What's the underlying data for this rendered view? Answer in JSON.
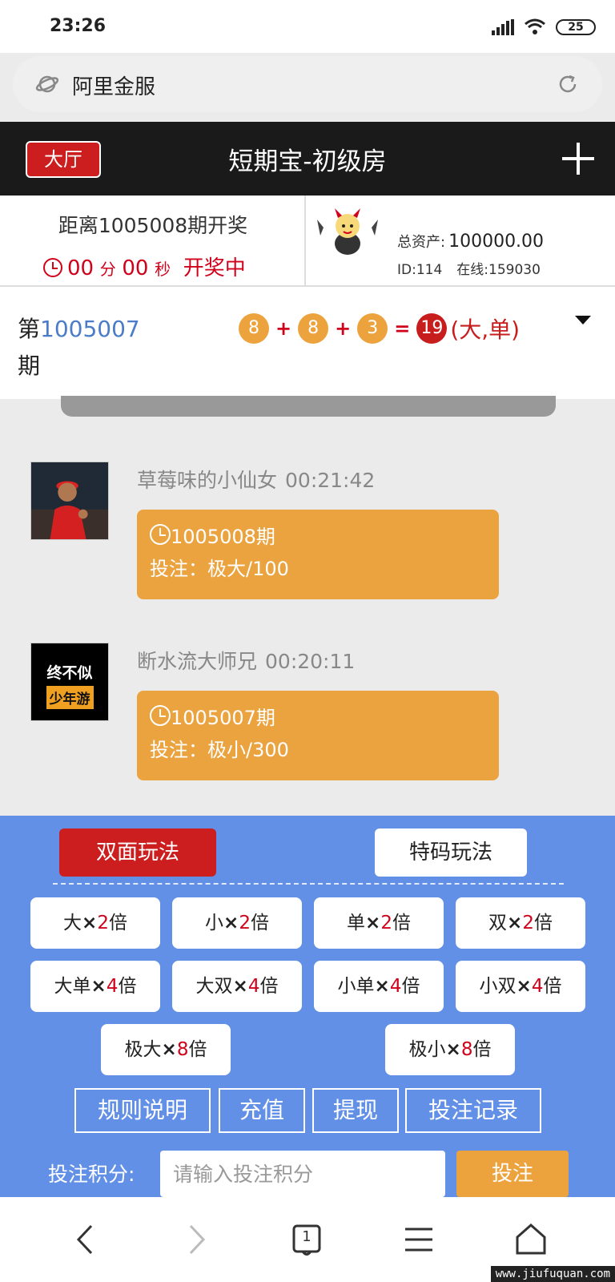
{
  "status_bar": {
    "time": "23:26",
    "battery": "25"
  },
  "url_bar": {
    "url": "阿里金服"
  },
  "header": {
    "hall_button": "大厅",
    "title": "短期宝-初级房"
  },
  "countdown": {
    "label": "距离1005008期开奖",
    "minutes": "00",
    "minutes_unit": "分",
    "seconds": "00",
    "seconds_unit": "秒",
    "status": "开奖中"
  },
  "user": {
    "assets_label": "总资产:",
    "assets_value": "100000.00",
    "id": "ID:114",
    "online": "在线:159030"
  },
  "last_result": {
    "prefix": "第",
    "period": "1005007",
    "suffix": "期",
    "balls": [
      "8",
      "8",
      "3"
    ],
    "plus": "+",
    "equals": "=",
    "sum": "19",
    "outcome": "(大,单)"
  },
  "messages": [
    {
      "nick": "草莓味的小仙女",
      "time": "00:21:42",
      "period": "1005008期",
      "bet": "投注：极大/100"
    },
    {
      "nick": "断水流大师兄",
      "time": "00:20:11",
      "period": "1005007期",
      "bet": "投注：极小/300",
      "avatar_line1": "终不似",
      "avatar_line2": "少年游"
    }
  ],
  "bet_panel": {
    "tabs": [
      {
        "label": "双面玩法",
        "active": true
      },
      {
        "label": "特码玩法",
        "active": false
      }
    ],
    "options": [
      {
        "name": "大",
        "x": "×",
        "mul": "2",
        "unit": "倍"
      },
      {
        "name": "小",
        "x": "×",
        "mul": "2",
        "unit": "倍"
      },
      {
        "name": "单",
        "x": "×",
        "mul": "2",
        "unit": "倍"
      },
      {
        "name": "双",
        "x": "×",
        "mul": "2",
        "unit": "倍"
      },
      {
        "name": "大单",
        "x": "×",
        "mul": "4",
        "unit": "倍"
      },
      {
        "name": "大双",
        "x": "×",
        "mul": "4",
        "unit": "倍"
      },
      {
        "name": "小单",
        "x": "×",
        "mul": "4",
        "unit": "倍"
      },
      {
        "name": "小双",
        "x": "×",
        "mul": "4",
        "unit": "倍"
      },
      {
        "name": "极大",
        "x": "×",
        "mul": "8",
        "unit": "倍"
      },
      {
        "name": "极小",
        "x": "×",
        "mul": "8",
        "unit": "倍"
      }
    ],
    "links": [
      "规则说明",
      "充值",
      "提现",
      "投注记录"
    ],
    "amount_label": "投注积分:",
    "amount_placeholder": "请输入投注积分",
    "submit": "投注"
  },
  "browser_nav": {
    "tab_count": "1"
  },
  "watermark": "www.jiufuquan.com",
  "colors": {
    "accent_red": "#cc1e1e",
    "bubble_orange": "#eba33f",
    "panel_blue": "#6390e7",
    "header_black": "#1a1a1a"
  }
}
